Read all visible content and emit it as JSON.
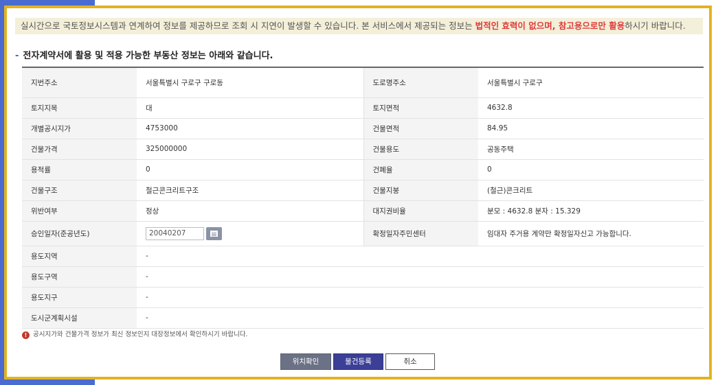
{
  "notice": {
    "text_part1": "실시간으로 국토정보시스템과 연계하여 정보를 제공하므로 조회 시 지연이 발생할 수 있습니다. 본 서비스에서 제공되는 정보는 ",
    "text_highlight1": "법적인 효력이 없으며, 참고용으로만 활용",
    "text_part2": "하시기 바랍니다."
  },
  "section": {
    "title": "전자계약서에 활용 및 적용 가능한 부동산 정보는 아래와 같습니다."
  },
  "rows": {
    "r1": {
      "l1": "지번주소",
      "v1": "서울특별시 구로구 구로동",
      "l2": "도로명주소",
      "v2": "서울특별시 구로구"
    },
    "r2": {
      "l1": "토지지목",
      "v1": "대",
      "l2": "토지면적",
      "v2": "4632.8"
    },
    "r3": {
      "l1": "개별공시지가",
      "v1": "4753000",
      "l2": "건물면적",
      "v2": "84.95"
    },
    "r4": {
      "l1": "건물가격",
      "v1": "325000000",
      "l2": "건물용도",
      "v2": "공동주택"
    },
    "r5": {
      "l1": "용적률",
      "v1": "0",
      "l2": "건폐율",
      "v2": "0"
    },
    "r6": {
      "l1": "건물구조",
      "v1": "철근콘크리트구조",
      "l2": "건물지붕",
      "v2": "(철근)콘크리트"
    },
    "r7": {
      "l1": "위반여부",
      "v1": "정상",
      "l2": "대지권비율",
      "v2": "분모 : 4632.8 분자 : 15.329"
    },
    "r8": {
      "l1": "승인일자(준공년도)",
      "date_value": "20040207",
      "l2": "확정일자주민센터",
      "v2": "임대자 주거용 계약만 확정일자신고 가능합니다."
    },
    "r9": {
      "l1": "용도지역",
      "v1": "-"
    },
    "r10": {
      "l1": "용도구역",
      "v1": "-"
    },
    "r11": {
      "l1": "용도지구",
      "v1": "-"
    },
    "r12": {
      "l1": "도시군계획시설",
      "v1": "-"
    }
  },
  "footnote": {
    "icon": "info-icon",
    "icon_glyph": "!",
    "text": "공시지가와 건물가격 정보가 최신 정보인지 대장정보에서 확인하시기 바랍니다."
  },
  "buttons": {
    "location": "위치확인",
    "register": "물건등록",
    "cancel": "취소"
  },
  "colors": {
    "frame_border": "#e2b320",
    "notice_bg": "#f3efd9",
    "highlight_red": "#e03a3a",
    "register_button": "#3b3f96",
    "location_button": "#6b7285",
    "side_blue": "#4a6bcf"
  }
}
